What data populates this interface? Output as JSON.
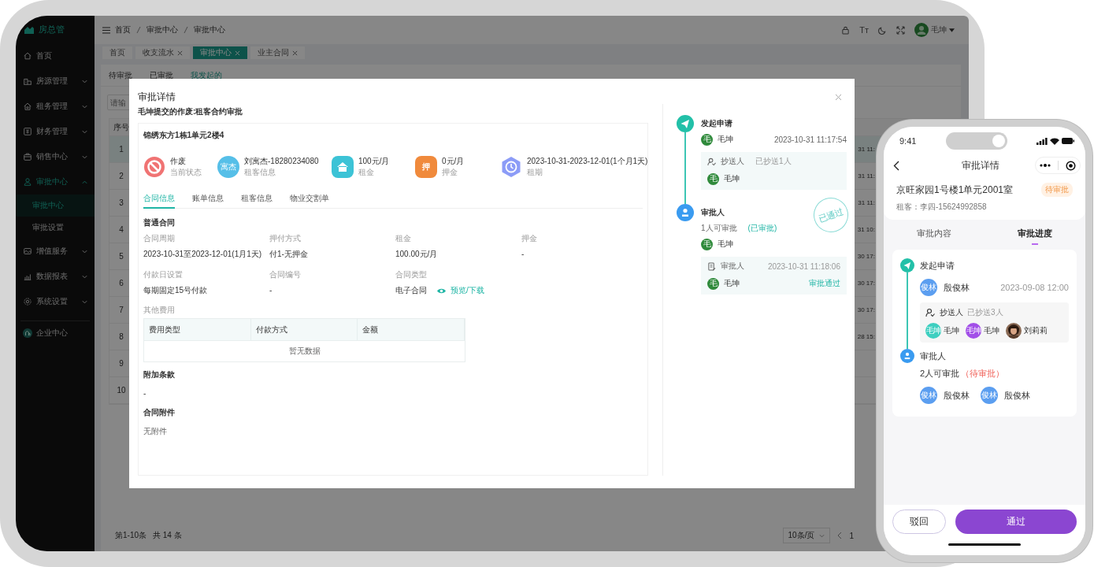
{
  "tablet": {
    "logo": "房总管",
    "sidebar": {
      "items": [
        {
          "label": "首页",
          "kind": "link",
          "selected": false
        },
        {
          "label": "房源管理",
          "kind": "group",
          "expanded": false,
          "selected": false
        },
        {
          "label": "租务管理",
          "kind": "group",
          "expanded": false,
          "selected": false
        },
        {
          "label": "财务管理",
          "kind": "group",
          "expanded": false,
          "selected": false
        },
        {
          "label": "销售中心",
          "kind": "group",
          "expanded": false,
          "selected": false
        },
        {
          "label": "审批中心",
          "kind": "group",
          "expanded": true,
          "selected": true,
          "children": [
            {
              "label": "审批中心",
              "selected": true
            },
            {
              "label": "审批设置",
              "selected": false
            }
          ]
        },
        {
          "label": "增值服务",
          "kind": "group",
          "expanded": false,
          "selected": false
        },
        {
          "label": "数据报表",
          "kind": "group",
          "expanded": false,
          "selected": false
        },
        {
          "label": "系统设置",
          "kind": "group",
          "expanded": false,
          "selected": false
        }
      ],
      "footer_item": "企业中心"
    },
    "breadcrumb": [
      "首页",
      "审批中心",
      "审批中心"
    ],
    "toolbar": {
      "font_size": "Tт",
      "user": "毛坤"
    },
    "page_tabs": [
      {
        "label": "首页",
        "closable": false,
        "selected": false
      },
      {
        "label": "收支流水",
        "closable": true,
        "selected": false
      },
      {
        "label": "审批中心",
        "closable": true,
        "selected": true
      },
      {
        "label": "业主合同",
        "closable": true,
        "selected": false
      }
    ],
    "sub_tabs": [
      {
        "label": "待审批",
        "selected": false
      },
      {
        "label": "已审批",
        "selected": false
      },
      {
        "label": "我发起的",
        "selected": true
      }
    ],
    "search": {
      "placeholder": "请输"
    },
    "table": {
      "columns": [
        "序号"
      ],
      "rows": [
        {
          "number": "1",
          "time": "31 11:",
          "highlighted": true
        },
        {
          "number": "2",
          "time": "31 11:",
          "highlighted": false
        },
        {
          "number": "3",
          "time": "31 11:",
          "highlighted": false
        },
        {
          "number": "4",
          "time": "31 10:",
          "highlighted": false
        },
        {
          "number": "5",
          "time": "30 17:",
          "highlighted": false
        },
        {
          "number": "6",
          "time": "30 17:",
          "highlighted": false
        },
        {
          "number": "7",
          "time": "30 17:",
          "highlighted": false
        },
        {
          "number": "8",
          "time": "28 15:",
          "highlighted": false
        },
        {
          "number": "9",
          "highlighted": false
        },
        {
          "number": "10",
          "highlighted": false
        }
      ]
    },
    "pagination": {
      "range": "第1-10条",
      "total": "共 14 条",
      "page_size": "10条/页",
      "page": "1"
    }
  },
  "modal": {
    "title": "审批详情",
    "subtitle": "毛坤提交的作废:租客合约审批",
    "property": "锦绣东方1栋1单元2楼4",
    "summary": [
      {
        "kind": "status",
        "value": "作废",
        "label": "当前状态"
      },
      {
        "kind": "avatar",
        "avatar": "寓杰",
        "value": "刘寓杰-18280234080",
        "label": "租客信息"
      },
      {
        "kind": "rent",
        "value": "100元/月",
        "label": "租金"
      },
      {
        "kind": "deposit",
        "badge": "押",
        "value": "0元/月",
        "label": "押金"
      },
      {
        "kind": "period",
        "value": "2023-10-31-2023-12-01(1个月1天)",
        "label": "租期"
      }
    ],
    "tabs": [
      {
        "label": "合同信息",
        "selected": true
      },
      {
        "label": "账单信息",
        "selected": false
      },
      {
        "label": "租客信息",
        "selected": false
      },
      {
        "label": "物业交割单",
        "selected": false
      }
    ],
    "contract": {
      "heading": "普通合同",
      "fields": [
        {
          "label": "合同周期",
          "value": "2023-10-31至2023-12-01(1月1天)"
        },
        {
          "label": "押付方式",
          "value": "付1-无押金"
        },
        {
          "label": "租金",
          "value": "100.00元/月"
        },
        {
          "label": "押金",
          "value": "-"
        },
        {
          "label": "付款日设置",
          "value": "每期固定15号付款"
        },
        {
          "label": "合同编号",
          "value": "-"
        },
        {
          "label": "合同类型",
          "value": "电子合同",
          "link": "预览/下载"
        }
      ],
      "fees": {
        "label": "其他费用",
        "columns": [
          "费用类型",
          "付款方式",
          "金额"
        ],
        "empty": "暂无数据"
      },
      "terms": {
        "heading": "附加条款",
        "value": "-"
      },
      "attachments": {
        "heading": "合同附件",
        "value": "无附件"
      }
    },
    "timeline": [
      {
        "kind": "submit",
        "title": "发起申请",
        "person": {
          "avatar": "毛",
          "name": "毛坤"
        },
        "time": "2023-10-31 11:17:54",
        "cc": {
          "label": "抄送人",
          "count": "已抄送1人",
          "people": [
            {
              "avatar": "毛",
              "name": "毛坤"
            }
          ]
        }
      },
      {
        "kind": "approver",
        "title": "审批人",
        "note": "1人可审批",
        "status": "(已审批)",
        "approved": true,
        "stamp": "已通过",
        "person": {
          "avatar": "毛",
          "name": "毛坤"
        },
        "record": {
          "label": "审批人",
          "time": "2023-10-31 11:18:06",
          "person": {
            "avatar": "毛",
            "name": "毛坤"
          },
          "result": "审批通过"
        }
      }
    ]
  },
  "phone": {
    "time": "9:41",
    "title": "审批详情",
    "property": "京旺家园1号楼1单元2001室",
    "badge": "待审批",
    "tenant": "租客：李四-15624992858",
    "tabs": [
      {
        "label": "审批内容",
        "selected": false
      },
      {
        "label": "审批进度",
        "selected": true
      }
    ],
    "timeline": [
      {
        "kind": "submit",
        "title": "发起申请",
        "person": {
          "avatar": "俊林",
          "name": "殷俊林"
        },
        "time": "2023-09-08 12:00",
        "cc": {
          "label": "抄送人",
          "count": "已抄送3人",
          "people": [
            {
              "kind": "initials",
              "avatar": "毛坤",
              "name": "毛坤",
              "color": "#3ecfc0"
            },
            {
              "kind": "initials",
              "avatar": "毛坤",
              "name": "毛坤",
              "color": "#a24fe8"
            },
            {
              "kind": "picture",
              "name": "刘莉莉"
            }
          ]
        }
      },
      {
        "kind": "approver",
        "title": "审批人",
        "note": "2人可审批",
        "status": "（待审批）",
        "approved": false,
        "people": [
          {
            "avatar": "俊林",
            "name": "殷俊林"
          },
          {
            "avatar": "俊林",
            "name": "殷俊林"
          }
        ]
      }
    ],
    "buttons": [
      {
        "label": "驳回",
        "kind": "secondary"
      },
      {
        "label": "通过",
        "kind": "primary"
      }
    ]
  }
}
